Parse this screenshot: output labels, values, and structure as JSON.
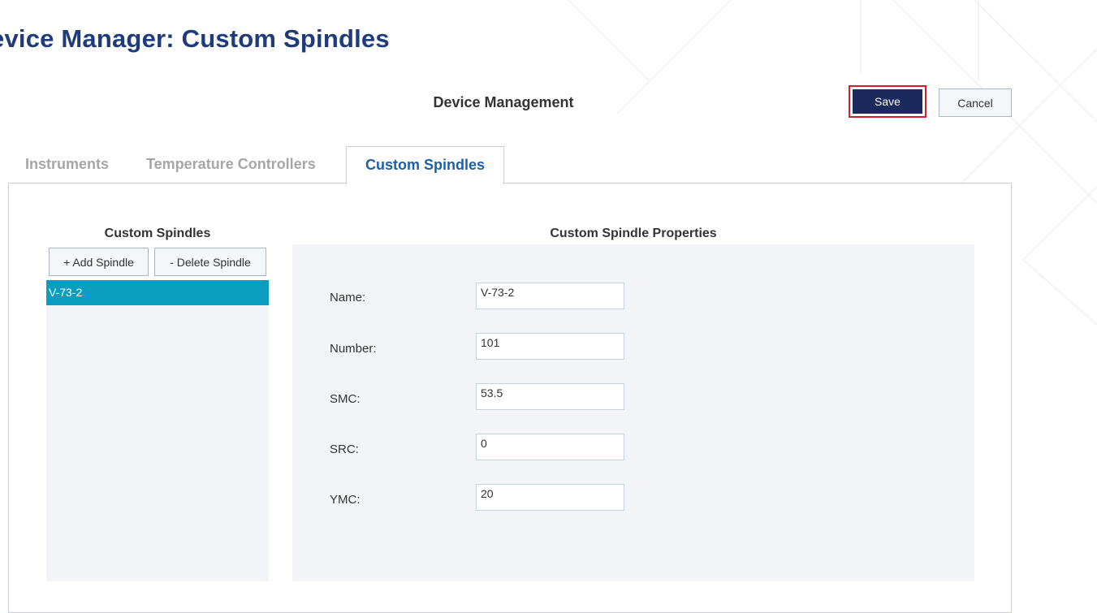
{
  "page": {
    "title": "evice Manager: Custom Spindles"
  },
  "dialog": {
    "title": "Device Management",
    "save_label": "Save",
    "cancel_label": "Cancel"
  },
  "tabs": {
    "instruments": "Instruments",
    "temperature_controllers": "Temperature Controllers",
    "custom_spindles": "Custom Spindles",
    "active": "custom_spindles"
  },
  "spindle_list": {
    "heading": "Custom Spindles",
    "add_label": "+ Add Spindle",
    "delete_label": "- Delete Spindle",
    "items": [
      "V-73-2"
    ],
    "selected_index": 0
  },
  "properties": {
    "heading": "Custom Spindle Properties",
    "name_label": "Name:",
    "name_value": "V-73-2",
    "number_label": "Number:",
    "number_value": "101",
    "smc_label": "SMC:",
    "smc_value": "53.5",
    "src_label": "SRC:",
    "src_value": "0",
    "ymc_label": "YMC:",
    "ymc_value": "20"
  },
  "colors": {
    "title": "#1f3b7a",
    "save_button": "#1b2a5c",
    "save_highlight": "#d1202a",
    "active_tab": "#1c5faa",
    "inactive_tab": "#a6a6a6",
    "selected_item": "#0a9dc0",
    "panel_background": "#f2f4f7"
  }
}
